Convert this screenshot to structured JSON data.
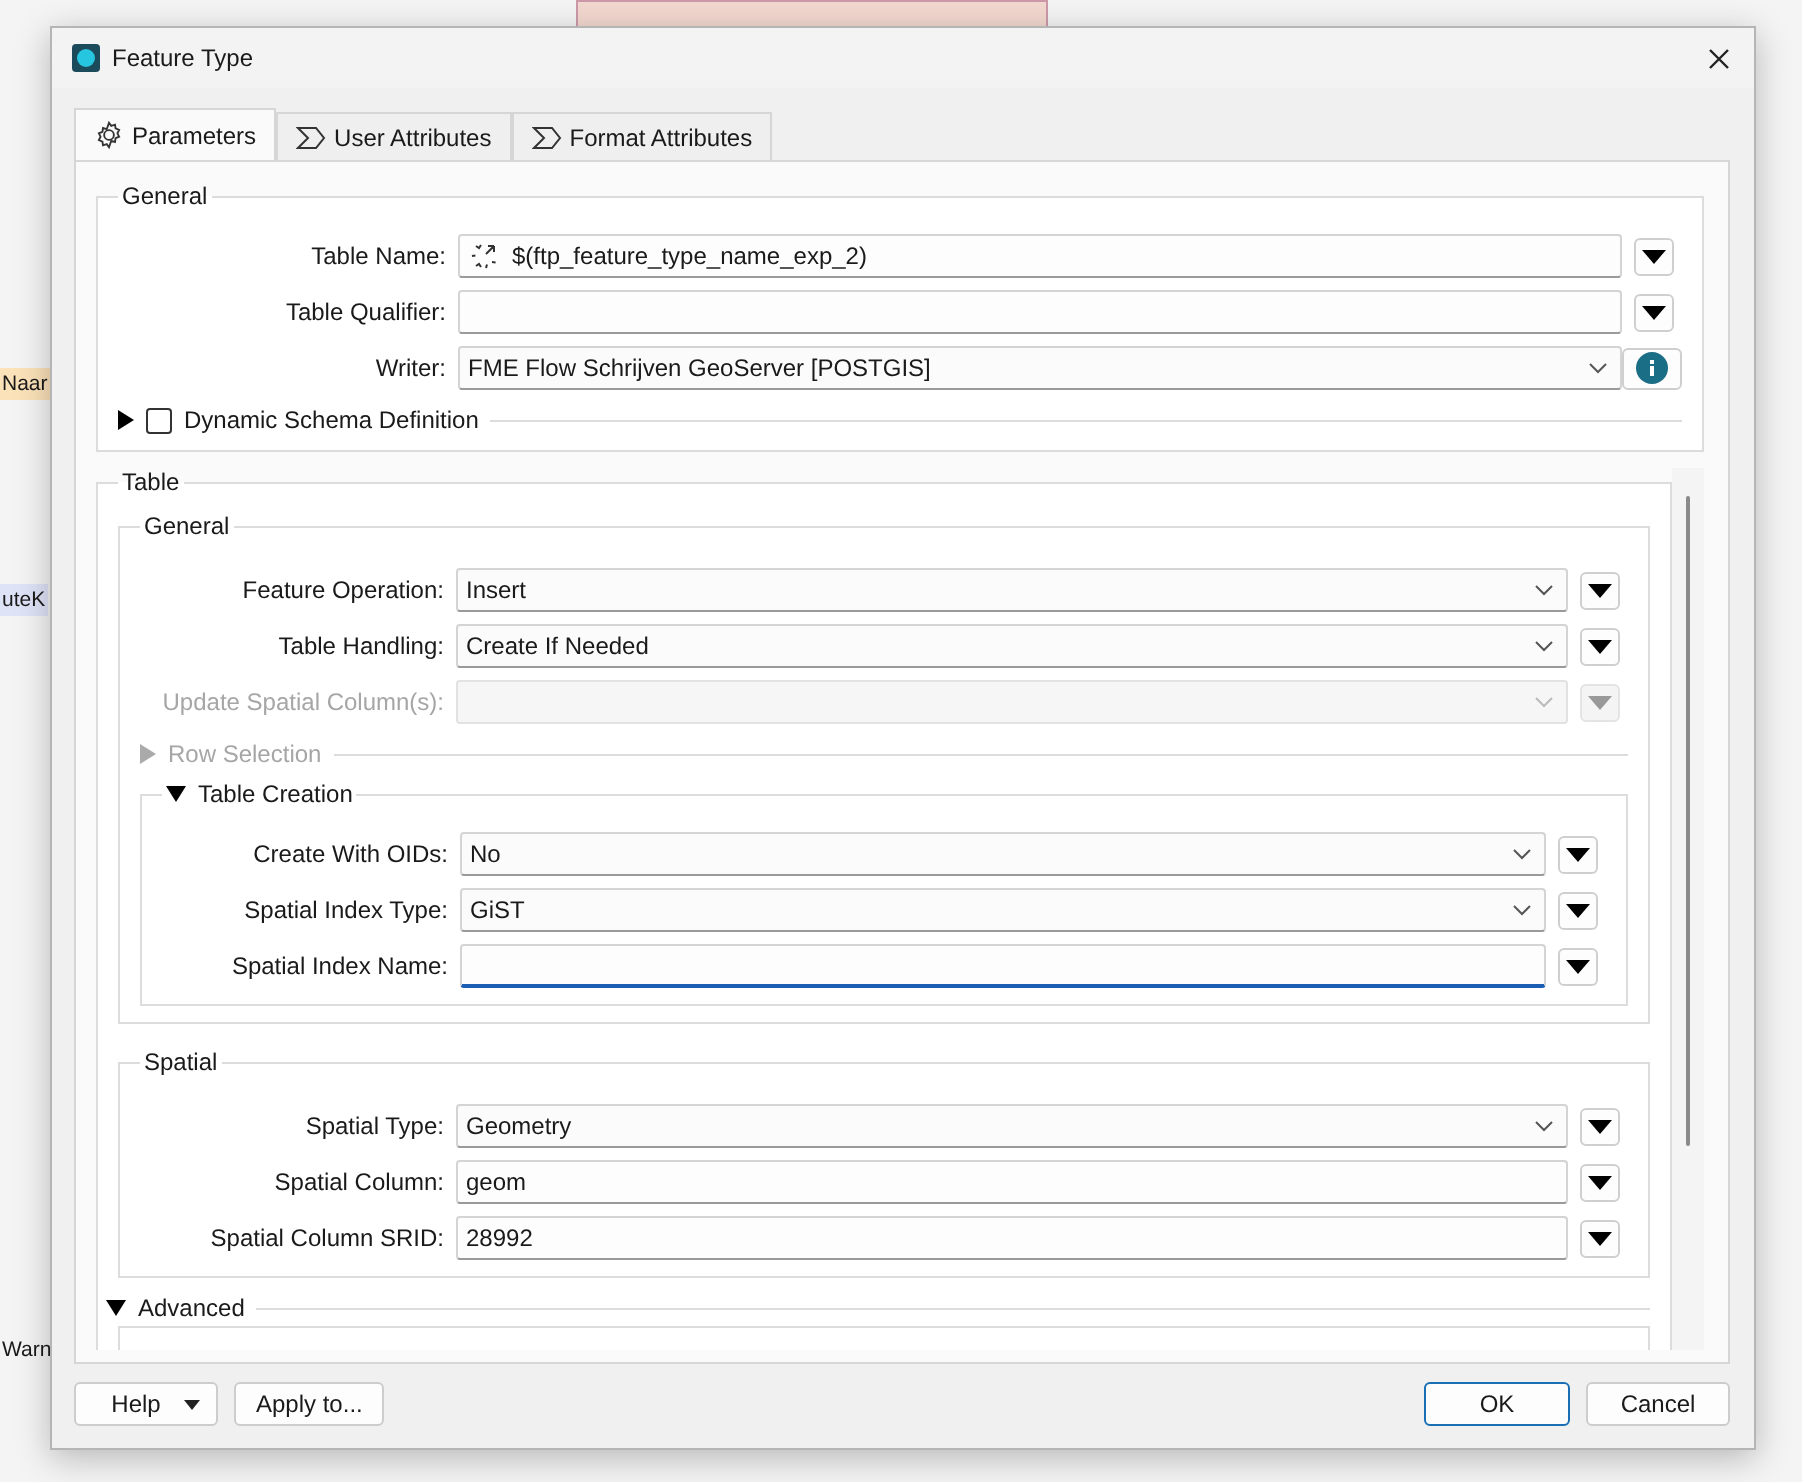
{
  "background": {
    "side_labels": [
      "Naar",
      "uteK",
      "Warn"
    ]
  },
  "window": {
    "title": "Feature Type"
  },
  "tabs": [
    {
      "label": "Parameters",
      "selected": true
    },
    {
      "label": "User Attributes",
      "selected": false
    },
    {
      "label": "Format Attributes",
      "selected": false
    }
  ],
  "general": {
    "title": "General",
    "fields": [
      {
        "label": "Table Name:",
        "value": "$(ftp_feature_type_name_exp_2)",
        "kind": "expression",
        "disabled": false,
        "focused": false
      },
      {
        "label": "Table Qualifier:",
        "kind": "text",
        "disabled": false,
        "focused": false
      },
      {
        "label": "Writer:",
        "value": "FME Flow Schrijven GeoServer [POSTGIS]",
        "kind": "writer",
        "disabled": false,
        "focused": false
      }
    ],
    "dynamic_schema": {
      "label": "Dynamic Schema Definition",
      "expanded": false,
      "checked": false
    }
  },
  "table": {
    "title": "Table",
    "general": {
      "title": "General",
      "fields": [
        {
          "label": "Feature Operation:",
          "value": "Insert",
          "kind": "select",
          "disabled": false,
          "focused": false
        },
        {
          "label": "Table Handling:",
          "value": "Create If Needed",
          "kind": "select",
          "disabled": false,
          "focused": false
        },
        {
          "label": "Update Spatial Column(s):",
          "kind": "select",
          "disabled": true,
          "focused": false
        }
      ]
    },
    "row_selection": {
      "label": "Row Selection",
      "expanded": false,
      "disabled": true
    },
    "table_creation": {
      "label": "Table Creation",
      "expanded": true,
      "disabled": false,
      "fields": [
        {
          "label": "Create With OIDs:",
          "value": "No",
          "kind": "select",
          "disabled": false,
          "focused": false
        },
        {
          "label": "Spatial Index Type:",
          "value": "GiST",
          "kind": "select",
          "disabled": false,
          "focused": false
        },
        {
          "label": "Spatial Index Name:",
          "kind": "text",
          "disabled": false,
          "focused": true
        }
      ]
    },
    "spatial": {
      "title": "Spatial",
      "fields": [
        {
          "label": "Spatial Type:",
          "value": "Geometry",
          "kind": "select",
          "disabled": false,
          "focused": false
        },
        {
          "label": "Spatial Column:",
          "value": "geom",
          "kind": "text",
          "disabled": false,
          "focused": false
        },
        {
          "label": "Spatial Column SRID:",
          "value": "28992",
          "kind": "text",
          "disabled": false,
          "focused": false
        }
      ]
    },
    "advanced": {
      "label": "Advanced",
      "expanded": true
    }
  },
  "footer": {
    "buttons": [
      {
        "label": "Help",
        "kind": "menu"
      },
      {
        "label": "Apply to...",
        "kind": "plain"
      },
      {
        "label": "OK",
        "kind": "default"
      },
      {
        "label": "Cancel",
        "kind": "plain"
      }
    ]
  }
}
